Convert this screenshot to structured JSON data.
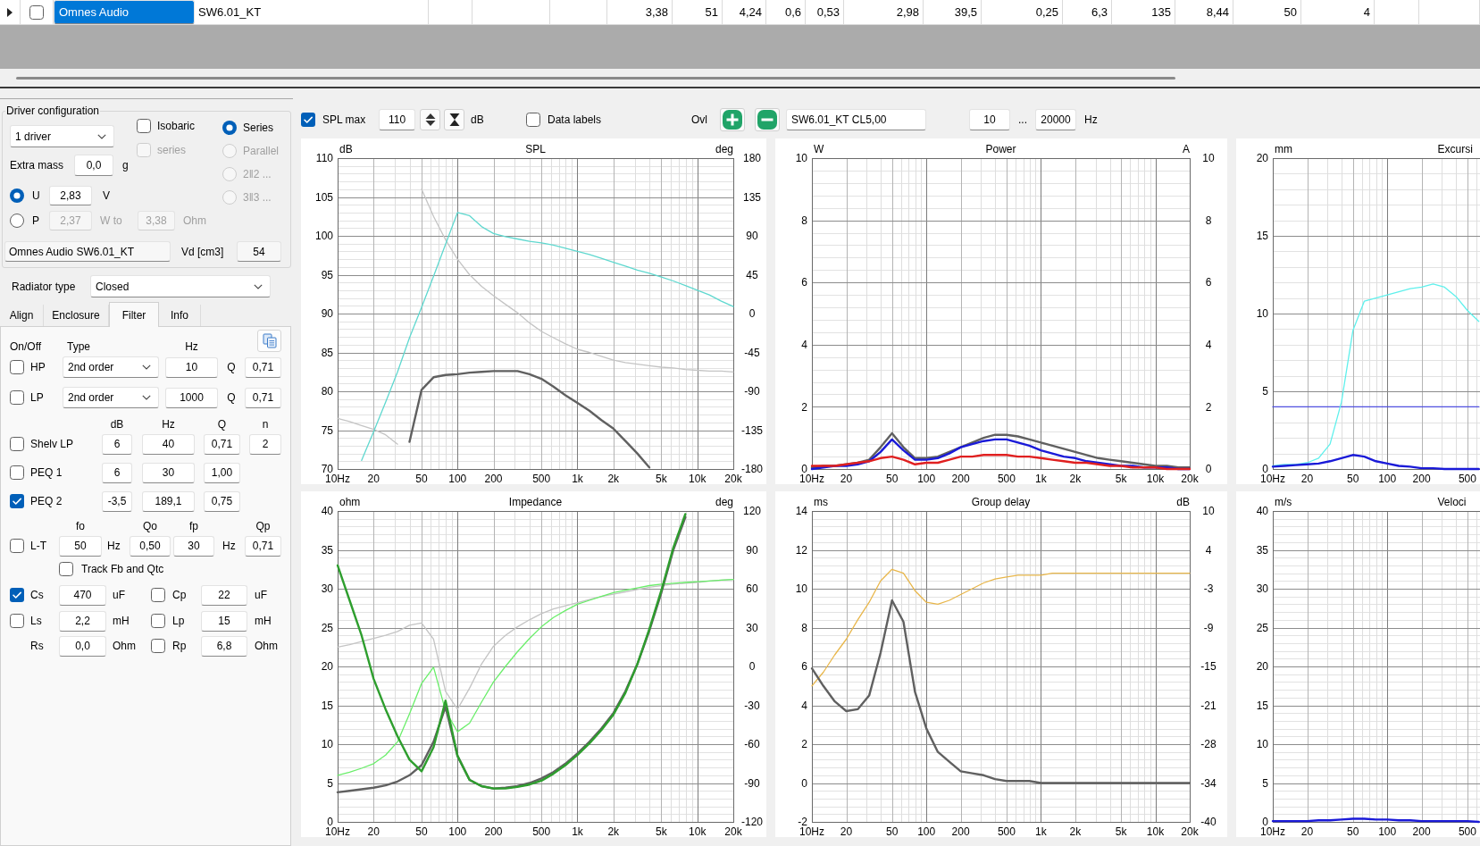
{
  "driver_table": {
    "rows": [
      {
        "checked": false,
        "cells": [
          {
            "text": "Omnes Audio",
            "selected": true
          },
          {
            "text": "SW6.01_KT",
            "selected": false
          },
          {
            "selected": false
          },
          {
            "selected": false
          },
          {
            "selected": false
          },
          {
            "text": "3,38",
            "selected": false
          },
          {
            "text": "51",
            "selected": false
          },
          {
            "text": "4,24",
            "selected": false
          },
          {
            "text": "0,6",
            "selected": false
          },
          {
            "text": "0,53",
            "selected": false
          },
          {
            "text": "2,98",
            "selected": false
          },
          {
            "text": "39,5",
            "selected": false
          },
          {
            "text": "0,25",
            "selected": false
          },
          {
            "text": "6,3",
            "selected": false
          },
          {
            "text": "135",
            "selected": false
          },
          {
            "text": "8,44",
            "selected": false
          },
          {
            "text": "50",
            "selected": false
          },
          {
            "text": "4",
            "selected": false
          },
          {
            "selected": false
          },
          {
            "selected": false
          }
        ]
      }
    ]
  },
  "driver_config": {
    "title": "Driver configuration",
    "drivers": "1 driver",
    "options": [
      {
        "label": "Isobaric",
        "checked": false,
        "disabled": false
      },
      {
        "label": "series",
        "checked": false,
        "disabled": true
      }
    ],
    "wiring": [
      {
        "label": "Series",
        "selected": true,
        "disabled": false
      },
      {
        "label": "Parallel",
        "selected": false,
        "disabled": true
      },
      {
        "label": "2‖2 ...",
        "selected": false,
        "disabled": true
      },
      {
        "label": "3‖3 ...",
        "selected": false,
        "disabled": true
      }
    ],
    "extra_mass": {
      "label": "Extra mass",
      "value": "0,0",
      "unit": "g"
    },
    "drive": [
      {
        "label": "U",
        "selected": true,
        "parts": [
          {
            "kind": "field",
            "text": "2,83",
            "disabled": false
          },
          {
            "kind": "unit",
            "text": "V",
            "disabled": false
          }
        ]
      },
      {
        "label": "P",
        "selected": false,
        "parts": [
          {
            "kind": "field",
            "text": "2,37",
            "disabled": true
          },
          {
            "kind": "unit",
            "text": "W to",
            "disabled": true
          },
          {
            "kind": "field",
            "text": "3,38",
            "disabled": true
          },
          {
            "kind": "unit",
            "text": "Ohm",
            "disabled": true
          }
        ]
      }
    ],
    "driver_name": "Omnes Audio SW6.01_KT",
    "vd": {
      "label": "Vd [cm3]",
      "value": "54"
    }
  },
  "radiator_type": {
    "label": "Radiator type",
    "value": "Closed"
  },
  "tabs": [
    {
      "label": "Align",
      "selected": false
    },
    {
      "label": "Enclosure",
      "selected": false
    },
    {
      "label": "Filter",
      "selected": true
    },
    {
      "label": "Info",
      "selected": false
    }
  ],
  "filter": {
    "crossover_headers": [
      "On/Off",
      "Type",
      "Hz"
    ],
    "crossover": [
      {
        "label": "HP",
        "checked": false,
        "type": "2nd order",
        "frequency": "10",
        "q_label": "Q",
        "q": "0,71"
      },
      {
        "label": "LP",
        "checked": false,
        "type": "2nd order",
        "frequency": "1000",
        "q_label": "Q",
        "q": "0,71"
      }
    ],
    "eq_headers": [
      "dB",
      "Hz",
      "Q",
      "n"
    ],
    "eq": [
      {
        "label": "Shelv LP",
        "checked": false,
        "values": [
          "6",
          "40",
          "0,71",
          "2"
        ]
      },
      {
        "label": "PEQ 1",
        "checked": false,
        "values": [
          "6",
          "30",
          "1,00"
        ]
      },
      {
        "label": "PEQ 2",
        "checked": true,
        "values": [
          "-3,5",
          "189,1",
          "0,75"
        ]
      }
    ],
    "lt_headers": [
      "fo",
      "Qo",
      "fp",
      "Qp"
    ],
    "lt": {
      "label": "L-T",
      "checked": false,
      "fo": "50",
      "fo_unit": "Hz",
      "qo": "0,50",
      "fp": "30",
      "fp_unit": "Hz",
      "qp": "0,71"
    },
    "track": {
      "label": "Track Fb and Qtc",
      "checked": false
    },
    "components": [
      {
        "series": {
          "kind": "switch",
          "label": "Cs",
          "checked": true,
          "value": "470",
          "unit": "uF"
        },
        "parallel": {
          "kind": "switch",
          "label": "Cp",
          "checked": false,
          "value": "22",
          "unit": "uF"
        }
      },
      {
        "series": {
          "kind": "switch",
          "label": "Ls",
          "checked": false,
          "value": "2,2",
          "unit": "mH"
        },
        "parallel": {
          "kind": "switch",
          "label": "Lp",
          "checked": false,
          "value": "15",
          "unit": "mH"
        }
      },
      {
        "series": {
          "kind": "fixed",
          "label": "Rs",
          "value": "0,0",
          "unit": "Ohm"
        },
        "parallel": {
          "kind": "switch",
          "label": "Rp",
          "checked": false,
          "value": "6,8",
          "unit": "Ohm"
        }
      }
    ]
  },
  "toolbar": {
    "spl_max": {
      "label": "SPL max",
      "checked": true,
      "value": "110",
      "unit": "dB"
    },
    "data_labels": {
      "label": "Data labels",
      "checked": false
    },
    "overlay": {
      "label": "Ovl",
      "value": "SW6.01_KT CL5,00"
    },
    "range": {
      "from": "10",
      "separator": "...",
      "to": "20000",
      "unit": "Hz"
    }
  },
  "charts": [
    {
      "chart_data": {
        "type": "line",
        "title": "SPL",
        "ylabel": "dB",
        "grid": true,
        "categories": [
          "10Hz",
          null,
          null,
          "20",
          null,
          null,
          null,
          "50",
          null,
          null,
          "100",
          null,
          null,
          "200",
          null,
          null,
          null,
          "500",
          null,
          null,
          "1k",
          null,
          null,
          "2k",
          null,
          null,
          null,
          "5k",
          null,
          null,
          "10k",
          null,
          null,
          "20k"
        ],
        "ylim": [
          70,
          110
        ],
        "yticks": [
          70,
          75,
          80,
          85,
          90,
          95,
          100,
          105,
          110
        ],
        "series": [
          {
            "color": "#c4c4c4",
            "values": [
              76.5,
              76.1,
              75.6,
              75.1,
              74.4,
              73.2,
              null,
              106,
              102.5,
              99.5,
              97,
              95,
              93.5,
              92.3,
              91.2,
              90.1,
              88.8,
              87.7,
              86.9,
              86.1,
              85.4,
              85,
              84.5,
              84,
              83.7,
              83.5,
              83.3,
              83.1,
              83,
              82.8,
              82.7,
              82.6,
              82.6,
              82.5
            ]
          },
          {
            "color": "#5fd8cf",
            "values": [
              null,
              null,
              71.1,
              74.8,
              78.6,
              82.5,
              86.9,
              90.8,
              94.8,
              98.9,
              103,
              102.6,
              101.2,
              100.3,
              99.9,
              99.6,
              99.3,
              99.1,
              98.8,
              98.4,
              98,
              97.6,
              97.1,
              96.6,
              96.1,
              95.6,
              95.2,
              94.7,
              94.2,
              93.6,
              93,
              92.4,
              91.6,
              90.9
            ]
          },
          {
            "color": "#606060",
            "values": [
              null,
              null,
              null,
              null,
              null,
              null,
              73.5,
              80.2,
              81.8,
              82.1,
              82.2,
              82.4,
              82.5,
              82.6,
              82.6,
              82.6,
              82.2,
              81.6,
              80.6,
              79.5,
              78.5,
              77.5,
              76.3,
              75.2,
              73.6,
              72,
              70.2,
              null,
              null,
              null,
              null,
              null,
              null,
              null
            ]
          }
        ]
      },
      "right_axis": {
        "label": "deg",
        "ticks": [
          "180",
          "135",
          "90",
          "45",
          "0",
          "-45",
          "-90",
          "-135",
          "-180"
        ]
      }
    },
    {
      "chart_data": {
        "type": "line",
        "title": "Power",
        "ylabel": "W",
        "grid": true,
        "categories": [
          "10Hz",
          null,
          null,
          "20",
          null,
          null,
          null,
          "50",
          null,
          null,
          "100",
          null,
          null,
          "200",
          null,
          null,
          null,
          "500",
          null,
          null,
          "1k",
          null,
          null,
          "2k",
          null,
          null,
          null,
          "5k",
          null,
          null,
          "10k",
          null,
          null,
          "20k"
        ],
        "ylim": [
          0,
          10
        ],
        "yticks": [
          0,
          2,
          4,
          6,
          8,
          10
        ],
        "series": [
          {
            "color": "#606060",
            "values": [
              0.05,
              0.1,
              0.1,
              0.15,
              0.2,
              0.3,
              0.7,
              1.15,
              0.7,
              0.35,
              0.35,
              0.4,
              0.55,
              0.7,
              0.85,
              1,
              1.1,
              1.1,
              1.05,
              0.95,
              0.85,
              0.75,
              0.65,
              0.55,
              0.45,
              0.35,
              0.3,
              0.25,
              0.2,
              0.15,
              0.1,
              0.1,
              0.05,
              0.05
            ]
          },
          {
            "color": "#1a1ad8",
            "values": [
              0,
              0.05,
              0.1,
              0.1,
              0.15,
              0.25,
              0.55,
              0.95,
              0.6,
              0.3,
              0.3,
              0.35,
              0.5,
              0.7,
              0.8,
              0.9,
              0.95,
              0.95,
              0.85,
              0.75,
              0.6,
              0.5,
              0.4,
              0.35,
              0.25,
              0.2,
              0.15,
              0.1,
              0.1,
              0.05,
              0.05,
              0.05,
              0,
              0
            ]
          },
          {
            "color": "#e02020",
            "values": [
              0.1,
              0.1,
              0.1,
              0.15,
              0.2,
              0.25,
              0.35,
              0.4,
              0.3,
              0.15,
              0.2,
              0.2,
              0.3,
              0.4,
              0.4,
              0.45,
              0.45,
              0.45,
              0.4,
              0.4,
              0.35,
              0.3,
              0.25,
              0.2,
              0.2,
              0.15,
              0.1,
              0.1,
              0.05,
              0.05,
              0.05,
              0,
              0,
              0
            ]
          }
        ]
      },
      "right_axis": {
        "label": "A",
        "ticks": [
          "10",
          "8",
          "6",
          "4",
          "2",
          "0"
        ]
      }
    },
    {
      "chart_data": {
        "type": "line",
        "title": "Excursi",
        "ylabel": "mm",
        "grid": true,
        "categories": [
          "10Hz",
          null,
          null,
          "20",
          null,
          null,
          null,
          "50",
          null,
          null,
          "100",
          null,
          null,
          "200",
          null,
          null,
          null,
          "500",
          null
        ],
        "ylim": [
          0,
          20
        ],
        "yticks": [
          0,
          5,
          10,
          15,
          20
        ],
        "series": [
          {
            "color": "#5050e0",
            "values": [
              4,
              4,
              4,
              4,
              4,
              4,
              4,
              4,
              4,
              4,
              4,
              4,
              4,
              4,
              4,
              4,
              4,
              4,
              4
            ]
          },
          {
            "color": "#5ff0ec",
            "values": [
              0.2,
              0.3,
              0.3,
              0.4,
              0.7,
              1.6,
              4.3,
              8.9,
              10.8,
              11,
              11.2,
              11.4,
              11.6,
              11.7,
              11.9,
              11.7,
              11.1,
              10.2,
              9.5
            ]
          },
          {
            "color": "#1a1ad8",
            "values": [
              0.15,
              0.2,
              0.25,
              0.3,
              0.35,
              0.5,
              0.7,
              0.9,
              0.8,
              0.5,
              0.35,
              0.2,
              0.15,
              0.05,
              0.05,
              0,
              0,
              0,
              0
            ]
          }
        ]
      }
    },
    {
      "chart_data": {
        "type": "line",
        "title": "Impedance",
        "ylabel": "ohm",
        "grid": true,
        "categories": [
          "10Hz",
          null,
          null,
          "20",
          null,
          null,
          null,
          "50",
          null,
          null,
          "100",
          null,
          null,
          "200",
          null,
          null,
          null,
          "500",
          null,
          null,
          "1k",
          null,
          null,
          "2k",
          null,
          null,
          null,
          "5k",
          null,
          null,
          "10k",
          null,
          null,
          "20k"
        ],
        "ylim": [
          0,
          40
        ],
        "yticks": [
          0,
          5,
          10,
          15,
          20,
          25,
          30,
          35,
          40
        ],
        "series": [
          {
            "color": "#c4c4c4",
            "values": [
              22.5,
              22.8,
              23.2,
              23.6,
              24,
              24.5,
              25.3,
              25.6,
              23.5,
              16.8,
              14.5,
              17.2,
              20.3,
              22.6,
              24,
              25.1,
              26,
              26.8,
              27.4,
              27.8,
              28.2,
              28.6,
              29,
              29.3,
              29.6,
              29.9,
              30.2,
              30.4,
              30.6,
              30.7,
              30.8,
              31,
              31.1,
              31.2
            ]
          },
          {
            "color": "#6aee6a",
            "values": [
              6,
              6.4,
              6.9,
              7.5,
              8.6,
              10.3,
              13.9,
              17.8,
              19.9,
              14.3,
              11.6,
              12.7,
              15.4,
              18,
              20,
              21.9,
              23.6,
              25.1,
              26.3,
              27.2,
              28,
              28.5,
              29,
              29.5,
              29.8,
              30.1,
              30.4,
              30.6,
              30.7,
              30.8,
              30.9,
              31,
              31.1,
              31.2
            ]
          },
          {
            "color": "#606060",
            "values": [
              3.8,
              4,
              4.2,
              4.4,
              4.7,
              5.2,
              6,
              7.3,
              10.3,
              14.8,
              8.5,
              5.4,
              4.6,
              4.3,
              4.4,
              4.6,
              5,
              5.6,
              6.4,
              7.5,
              8.8,
              10.3,
              12,
              14,
              16.8,
              20.3,
              24.6,
              29.5,
              35,
              39.2,
              null,
              null,
              null,
              null
            ]
          },
          {
            "color": "#2e9e2e",
            "values": [
              33,
              28.5,
              24,
              18.4,
              14.5,
              11,
              8,
              6.5,
              9.6,
              15.6,
              8.5,
              5.4,
              4.6,
              4.3,
              4.3,
              4.5,
              4.8,
              5.3,
              6.2,
              7.3,
              8.6,
              10.1,
              11.8,
              13.8,
              16.6,
              20.3,
              24.8,
              29.8,
              35.3,
              39.6,
              null,
              null,
              null,
              null
            ]
          }
        ]
      },
      "right_axis": {
        "label": "deg",
        "ticks": [
          "120",
          "90",
          "60",
          "30",
          "0",
          "-30",
          "-60",
          "-90",
          "-120"
        ]
      }
    },
    {
      "chart_data": {
        "type": "line",
        "title": "Group delay",
        "ylabel": "ms",
        "grid": true,
        "categories": [
          "10Hz",
          null,
          null,
          "20",
          null,
          null,
          null,
          "50",
          null,
          null,
          "100",
          null,
          null,
          "200",
          null,
          null,
          null,
          "500",
          null,
          null,
          "1k",
          null,
          null,
          "2k",
          null,
          null,
          null,
          "5k",
          null,
          null,
          "10k",
          null,
          null,
          "20k"
        ],
        "ylim": [
          -2,
          14
        ],
        "yticks": [
          -2,
          0,
          2,
          4,
          6,
          8,
          10,
          12,
          14
        ],
        "series": [
          {
            "color": "#e8b64a",
            "values": [
              5,
              5.7,
              6.6,
              7.4,
              8.4,
              9.3,
              10.4,
              11,
              10.8,
              9.9,
              9.3,
              9.2,
              9.4,
              9.7,
              10,
              10.3,
              10.5,
              10.6,
              10.7,
              10.7,
              10.7,
              10.8,
              10.8,
              10.8,
              10.8,
              10.8,
              10.8,
              10.8,
              10.8,
              10.8,
              10.8,
              10.8,
              10.8,
              10.8
            ]
          },
          {
            "color": "#606060",
            "values": [
              5.9,
              5,
              4.2,
              3.7,
              3.8,
              4.5,
              6.7,
              9.4,
              8.3,
              4.7,
              2.8,
              1.6,
              1.1,
              0.6,
              0.5,
              0.4,
              0.2,
              0.1,
              0.1,
              0.1,
              0,
              0,
              0,
              0,
              0,
              0,
              0,
              0,
              0,
              0,
              0,
              0,
              0,
              0
            ]
          }
        ]
      },
      "right_axis": {
        "label": "dB",
        "ticks": [
          "10",
          "4",
          "-3",
          "-9",
          "-15",
          "-21",
          "-28",
          "-34",
          "-40"
        ]
      }
    },
    {
      "chart_data": {
        "type": "line",
        "title": "Veloci",
        "ylabel": "m/s",
        "grid": true,
        "categories": [
          "10Hz",
          null,
          null,
          "20",
          null,
          null,
          null,
          "50",
          null,
          null,
          "100",
          null,
          null,
          "200",
          null,
          null,
          null,
          "500",
          null
        ],
        "ylim": [
          0,
          40
        ],
        "yticks": [
          0,
          5,
          10,
          15,
          20,
          25,
          30,
          35,
          40
        ],
        "series": [
          {
            "color": "#1a1ad8",
            "values": [
              0.1,
              0.1,
              0.1,
              0.1,
              0.2,
              0.2,
              0.3,
              0.4,
              0.4,
              0.3,
              0.3,
              0.2,
              0.2,
              0.1,
              0.1,
              0.1,
              0.1,
              0.1,
              0
            ]
          }
        ]
      }
    }
  ]
}
